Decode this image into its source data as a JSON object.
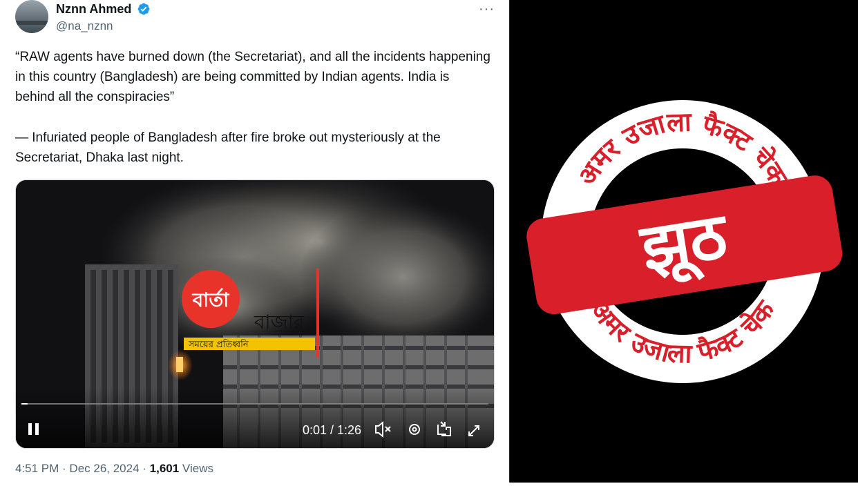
{
  "tweet": {
    "author_name": "Nznn Ahmed",
    "author_handle": "@na_nznn",
    "more_label": "···",
    "quote": "“RAW agents have burned down (the Secretariat), and all the incidents happening in this country (Bangladesh) are being committed by Indian agents. India is behind all the conspiracies”",
    "attribution": "— Infuriated people of Bangladesh after fire broke out mysteriously at the Secretariat, Dhaka last night.",
    "timestamp": "4:51 PM · Dec 26, 2024 · ",
    "views_count": "1,601",
    "views_label": " Views"
  },
  "video": {
    "logo_word": "বার্তা",
    "logo_word2": "বাজার",
    "tagline": "সময়ের প্রতিধ্বনি",
    "time": "0:01 / 1:26",
    "progress": 0.013
  },
  "stamp": {
    "verdict": "झूठ",
    "ring_text_top": "अमर उजाला फैक्ट चेक",
    "ring_text_bottom": "अमर उजाला फैक्ट चेक"
  },
  "colors": {
    "verified_blue": "#1d9bf0",
    "stamp_red": "#d81f2a",
    "logo_red": "#e8332b"
  }
}
